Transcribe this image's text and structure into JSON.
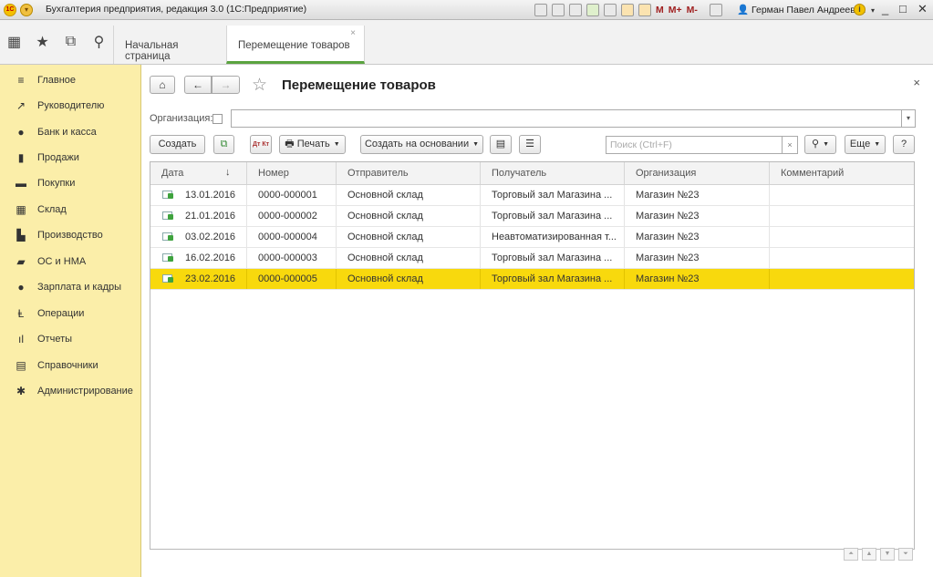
{
  "window": {
    "title": "Бухгалтерия предприятия, редакция 3.0  (1С:Предприятие)",
    "mem_buttons": [
      "M",
      "M+",
      "M-"
    ],
    "user": "Герман Павел Андреевич",
    "controls": [
      "_",
      "□",
      "✕"
    ]
  },
  "tabs": {
    "home": "Начальная страница",
    "active": "Перемещение товаров",
    "close": "×"
  },
  "sidebar": {
    "items": [
      {
        "label": "Главное",
        "icon": "≡"
      },
      {
        "label": "Руководителю",
        "icon": "↗"
      },
      {
        "label": "Банк и касса",
        "icon": "●"
      },
      {
        "label": "Продажи",
        "icon": "▮"
      },
      {
        "label": "Покупки",
        "icon": "▬"
      },
      {
        "label": "Склад",
        "icon": "▦"
      },
      {
        "label": "Производство",
        "icon": "▙"
      },
      {
        "label": "ОС и НМА",
        "icon": "▰"
      },
      {
        "label": "Зарплата и кадры",
        "icon": "●"
      },
      {
        "label": "Операции",
        "icon": "Ⱡ"
      },
      {
        "label": "Отчеты",
        "icon": "ıl"
      },
      {
        "label": "Справочники",
        "icon": "▤"
      },
      {
        "label": "Администрирование",
        "icon": "✱"
      }
    ]
  },
  "form": {
    "title": "Перемещение товаров",
    "close": "×",
    "org_label": "Организация:",
    "org_value": "",
    "buttons": {
      "create": "Создать",
      "print": "Печать",
      "create_based": "Создать на основании",
      "more": "Еще",
      "help": "?"
    },
    "search_placeholder": "Поиск (Ctrl+F)"
  },
  "table": {
    "columns": [
      "Дата",
      "Номер",
      "Отправитель",
      "Получатель",
      "Организация",
      "Комментарий"
    ],
    "sort_indicator": "↓",
    "rows": [
      {
        "date": "13.01.2016",
        "number": "0000-000001",
        "sender": "Основной склад",
        "receiver": "Торговый зал Магазина ...",
        "org": "Магазин №23",
        "comment": ""
      },
      {
        "date": "21.01.2016",
        "number": "0000-000002",
        "sender": "Основной склад",
        "receiver": "Торговый зал Магазина ...",
        "org": "Магазин №23",
        "comment": ""
      },
      {
        "date": "03.02.2016",
        "number": "0000-000004",
        "sender": "Основной склад",
        "receiver": "Неавтоматизированная т...",
        "org": "Магазин №23",
        "comment": ""
      },
      {
        "date": "16.02.2016",
        "number": "0000-000003",
        "sender": "Основной склад",
        "receiver": "Торговый зал Магазина ...",
        "org": "Магазин №23",
        "comment": ""
      },
      {
        "date": "23.02.2016",
        "number": "0000-000005",
        "sender": "Основной склад",
        "receiver": "Торговый зал Магазина ...",
        "org": "Магазин №23",
        "comment": ""
      }
    ],
    "selected_row": 4
  },
  "colors": {
    "sidebar_bg": "#fbeea9",
    "selection": "#f8d90d",
    "active_tab_underline": "#5aa33f"
  }
}
